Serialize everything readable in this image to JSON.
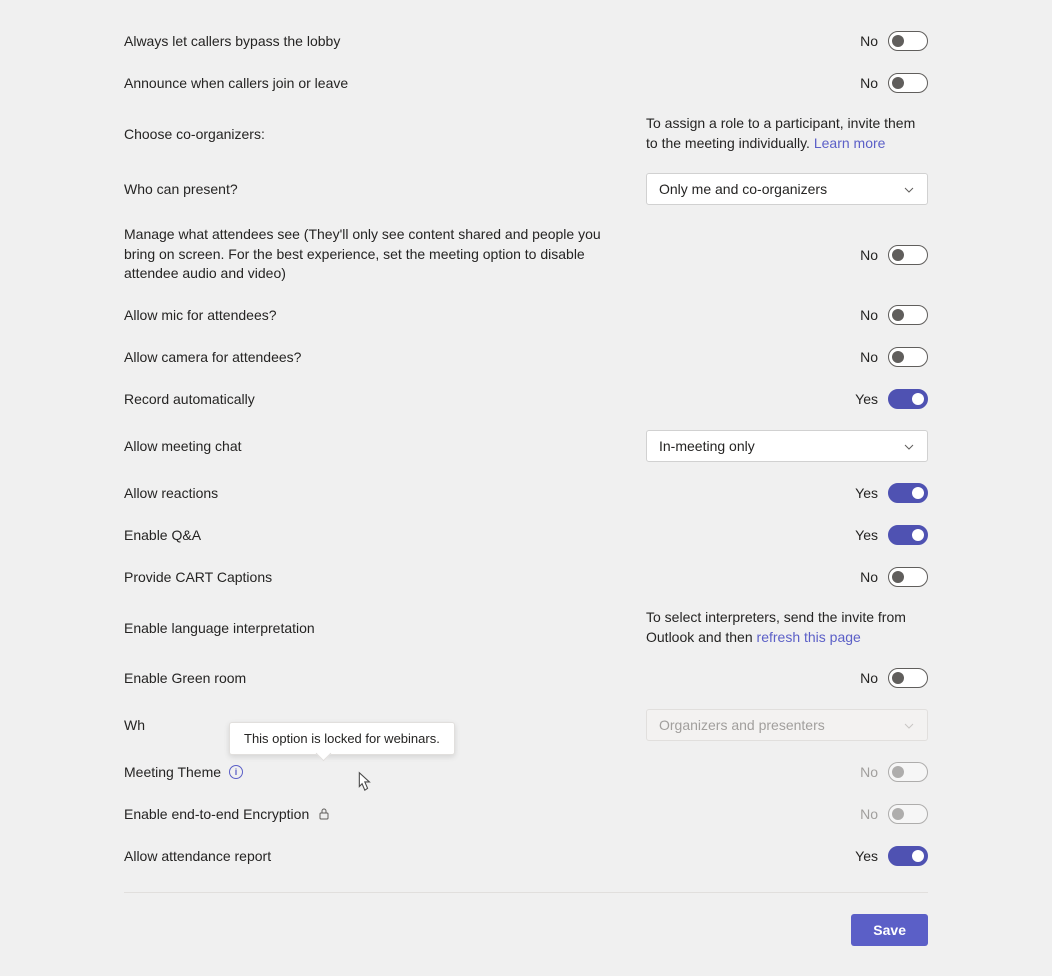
{
  "toggle_states": {
    "yes": "Yes",
    "no": "No"
  },
  "options": {
    "bypass_lobby": {
      "label": "Always let callers bypass the lobby",
      "value": false
    },
    "announce_callers": {
      "label": "Announce when callers join or leave",
      "value": false
    },
    "co_organizers": {
      "label": "Choose co-organizers:",
      "info": "To assign a role to a participant, invite them to the meeting individually. ",
      "link": "Learn more"
    },
    "who_can_present": {
      "label": "Who can present?",
      "value": "Only me and co-organizers"
    },
    "manage_attendees": {
      "label": "Manage what attendees see (They'll only see content shared and people you bring on screen. For the best experience, set the meeting option to disable attendee audio and video)",
      "value": false
    },
    "allow_mic": {
      "label": "Allow mic for attendees?",
      "value": false
    },
    "allow_camera": {
      "label": "Allow camera for attendees?",
      "value": false
    },
    "record_auto": {
      "label": "Record automatically",
      "value": true
    },
    "meeting_chat": {
      "label": "Allow meeting chat",
      "value": "In-meeting only"
    },
    "allow_reactions": {
      "label": "Allow reactions",
      "value": true
    },
    "enable_qa": {
      "label": "Enable Q&A",
      "value": true
    },
    "cart_captions": {
      "label": "Provide CART Captions",
      "value": false
    },
    "language_interp": {
      "label": "Enable language interpretation",
      "info": "To select interpreters, send the invite from Outlook and then ",
      "link": "refresh this page"
    },
    "green_room": {
      "label": "Enable Green room",
      "value": false
    },
    "who_has_lobby": {
      "label": "Wh",
      "value": "Organizers and presenters"
    },
    "meeting_theme": {
      "label": "Meeting Theme",
      "value": false,
      "tooltip": "This option is locked for webinars."
    },
    "e2e_encrypt": {
      "label": "Enable end-to-end Encryption",
      "value": false
    },
    "attendance_report": {
      "label": "Allow attendance report",
      "value": true
    }
  },
  "footer": {
    "save": "Save"
  }
}
